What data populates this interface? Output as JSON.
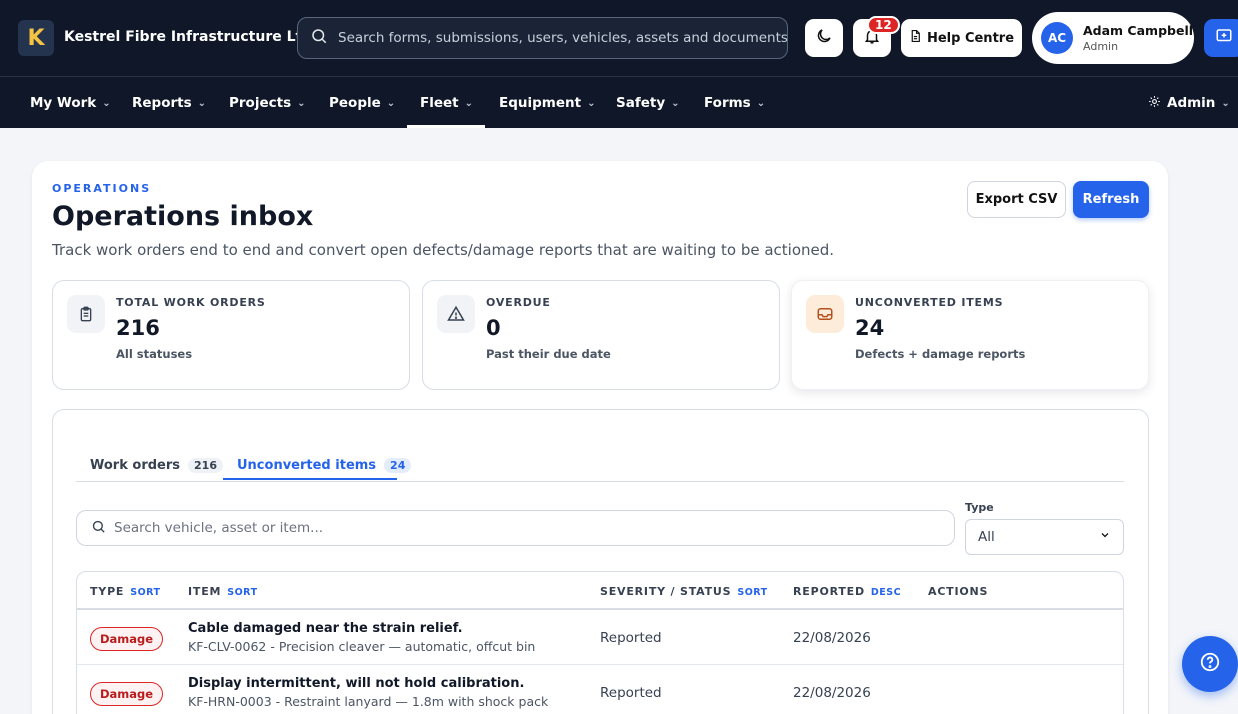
{
  "header": {
    "logo_letter": "K",
    "company": "Kestrel Fibre Infrastructure Ltd",
    "search_placeholder": "Search forms, submissions, users, vehicles, assets and documents..",
    "notifications_count": "12",
    "help_label": "Help Centre",
    "user": {
      "initials": "AC",
      "name": "Adam Campbell",
      "role": "Admin"
    }
  },
  "nav": {
    "items": [
      {
        "label": "My Work"
      },
      {
        "label": "Reports"
      },
      {
        "label": "Projects"
      },
      {
        "label": "People"
      },
      {
        "label": "Fleet",
        "active": true
      },
      {
        "label": "Equipment"
      },
      {
        "label": "Safety"
      },
      {
        "label": "Forms"
      }
    ],
    "admin_label": "Admin"
  },
  "page": {
    "eyebrow": "OPERATIONS",
    "title": "Operations inbox",
    "description": "Track work orders end to end and convert open defects/damage reports that are waiting to be actioned.",
    "export_label": "Export CSV",
    "refresh_label": "Refresh"
  },
  "stats": [
    {
      "label": "TOTAL WORK ORDERS",
      "value": "216",
      "sub": "All statuses",
      "icon": "clipboard-icon"
    },
    {
      "label": "OVERDUE",
      "value": "0",
      "sub": "Past their due date",
      "icon": "warning-triangle-icon"
    },
    {
      "label": "UNCONVERTED ITEMS",
      "value": "24",
      "sub": "Defects + damage reports",
      "icon": "inbox-tray-icon"
    }
  ],
  "tabs": [
    {
      "label": "Work orders",
      "count": "216"
    },
    {
      "label": "Unconverted items",
      "count": "24",
      "active": true
    }
  ],
  "filters": {
    "search_placeholder": "Search vehicle, asset or item...",
    "type_label": "Type",
    "type_value": "All"
  },
  "table": {
    "columns": [
      {
        "label": "TYPE",
        "sort": "SORT"
      },
      {
        "label": "ITEM",
        "sort": "SORT"
      },
      {
        "label": "SEVERITY / STATUS",
        "sort": "SORT"
      },
      {
        "label": "REPORTED",
        "sort": "DESC"
      },
      {
        "label": "ACTIONS",
        "sort": ""
      }
    ],
    "rows": [
      {
        "type": "Damage",
        "title": "Cable damaged near the strain relief.",
        "subtitle": "KF-CLV-0062 - Precision cleaver — automatic, offcut bin",
        "status": "Reported",
        "date": "22/08/2026"
      },
      {
        "type": "Damage",
        "title": "Display intermittent, will not hold calibration.",
        "subtitle": "KF-HRN-0003 - Restraint lanyard — 1.8m with shock pack",
        "status": "Reported",
        "date": "22/08/2026"
      }
    ]
  },
  "colors": {
    "accent": "#2563eb",
    "topbar": "#0f1729",
    "danger": "#dc2626",
    "highlight_icon_bg": "#fdecd9"
  }
}
